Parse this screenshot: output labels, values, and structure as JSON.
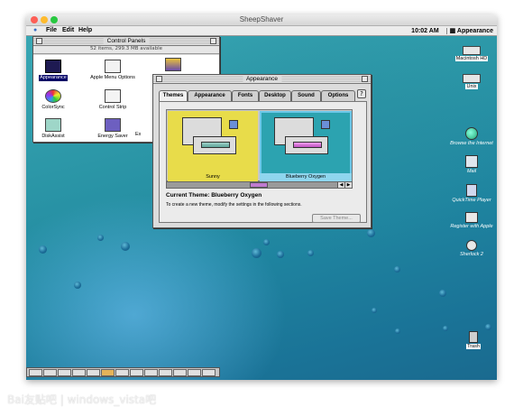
{
  "host_window": {
    "title": "SheepShaver"
  },
  "menubar": {
    "apple": "",
    "items": [
      "File",
      "Edit",
      "Help"
    ],
    "clock": "10:02 AM",
    "app_menu": "Appearance"
  },
  "control_panels": {
    "title": "Control Panels",
    "info": "52 items, 299.3 MB available",
    "items": [
      "Appearance",
      "Apple Menu Options",
      "ColorSync",
      "Control Strip",
      "DiskAssist",
      "Energy Saver",
      "Ex"
    ]
  },
  "appearance": {
    "title": "Appearance",
    "tabs": [
      "Themes",
      "Appearance",
      "Fonts",
      "Desktop",
      "Sound",
      "Options"
    ],
    "themes": [
      "Sunny",
      "Blueberry Oxygen"
    ],
    "current_theme_label": "Current Theme: Blueberry Oxygen",
    "instructions": "To create a new theme, modify the settings in the following sections.",
    "save_button": "Save Theme..."
  },
  "desktop_icons": [
    "Macintosh HD",
    "Unix",
    "Browse the Internet",
    "Mail",
    "QuickTime Player",
    "Register with Apple",
    "Sherlock 2",
    "Trash"
  ],
  "watermark": "Bai友贴吧 | windows_vista吧",
  "colors": {
    "desktop": "#1f85a0",
    "sunny": "#e8dc4a",
    "blueberry": "#2ca3b0",
    "selection": "#000066"
  }
}
